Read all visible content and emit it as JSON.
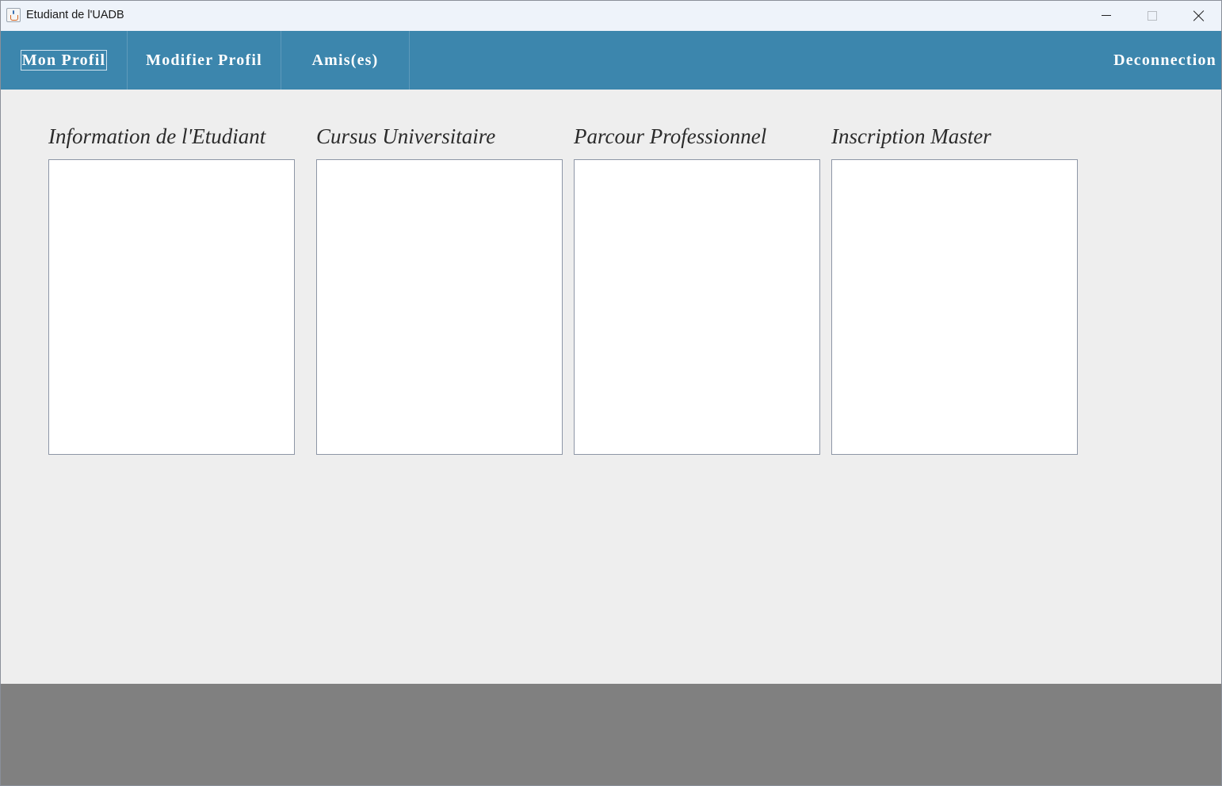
{
  "window": {
    "title": "Etudiant de l'UADB",
    "icon": "java-cup-icon",
    "controls": [
      "minimize-icon",
      "maximize-icon",
      "close-icon"
    ]
  },
  "nav": {
    "mon_profil": "Mon Profil",
    "modifier_profil": "Modifier Profil",
    "amis": "Amis(es)",
    "deconnection": "Deconnection",
    "color": "#3c86ad",
    "selected": "Mon Profil"
  },
  "sections": {
    "info": {
      "title": "Information de l'Etudiant"
    },
    "cursus": {
      "title": "Cursus Universitaire"
    },
    "parcours": {
      "title": "Parcour Professionnel"
    },
    "master": {
      "title": "Inscription Master"
    }
  },
  "colors": {
    "content_bg": "#eeeeee",
    "footer_bg": "#808080",
    "panel_bg": "#ffffff"
  }
}
